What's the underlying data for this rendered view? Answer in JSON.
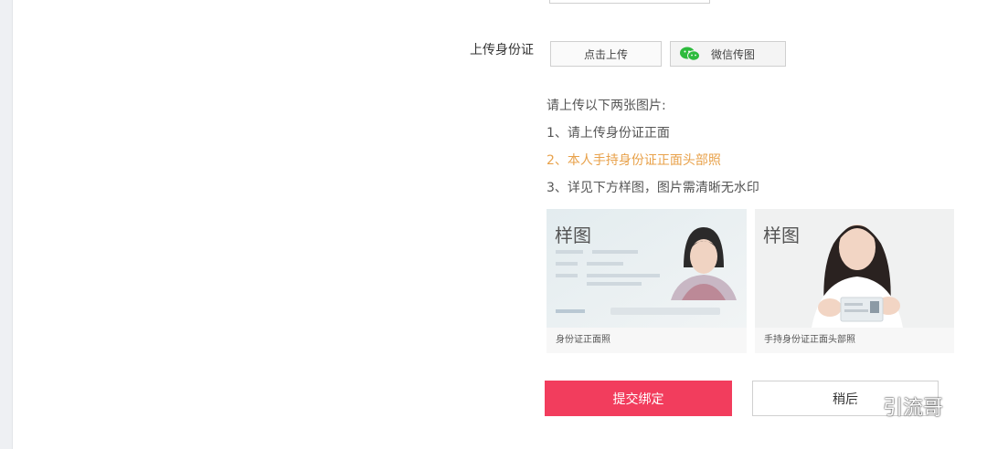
{
  "form": {
    "upload_id_label": "上传身份证",
    "click_upload_label": "点击上传",
    "wechat_upload_label": "微信传图"
  },
  "instructions": {
    "heading": "请上传以下两张图片:",
    "items": [
      "1、请上传身份证正面",
      "2、本人手持身份证正面头部照",
      "3、详见下方样图，图片需清晰无水印"
    ]
  },
  "samples": [
    {
      "tag": "样图",
      "caption": "身份证正面照"
    },
    {
      "tag": "样图",
      "caption": "手持身份证正面头部照"
    }
  ],
  "actions": {
    "submit_label": "提交绑定",
    "later_label": "稍后"
  },
  "watermark": {
    "text": "引流哥"
  },
  "colors": {
    "submit_bg": "#f23d5d",
    "highlight": "#e8a14a",
    "wechat_green": "#2dbb3d"
  }
}
